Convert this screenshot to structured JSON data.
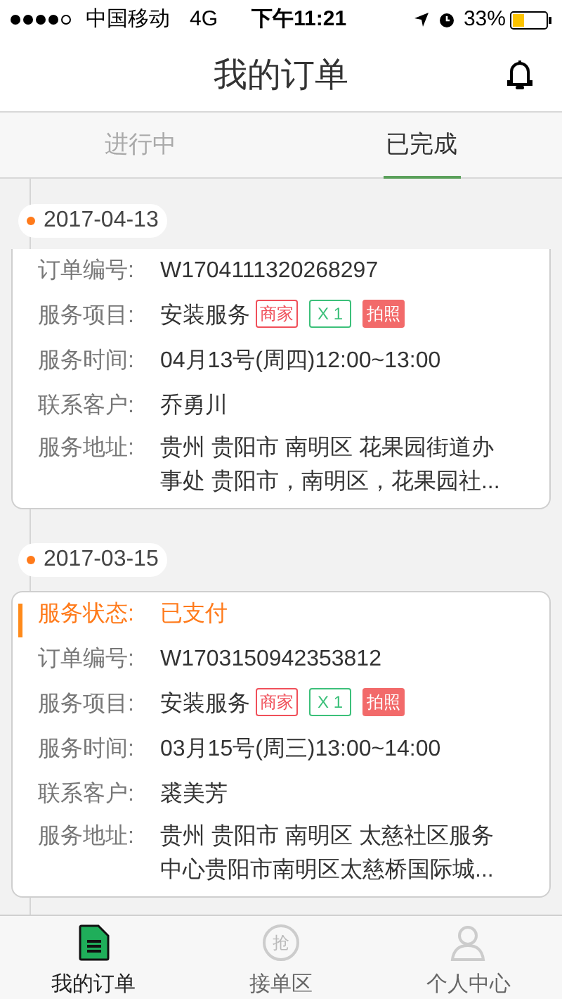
{
  "status_bar": {
    "carrier": "中国移动",
    "network": "4G",
    "time": "下午11:21",
    "battery": "33%"
  },
  "header": {
    "title": "我的订单"
  },
  "tabs": [
    {
      "label": "进行中",
      "selected": false
    },
    {
      "label": "已完成",
      "selected": true
    }
  ],
  "orders": [
    {
      "date": "2017-04-13",
      "top_cut": true,
      "fields": [
        {
          "label": "订单编号:",
          "value": "W1704111320268297"
        },
        {
          "kind": "tags",
          "label": "服务项目:",
          "value": "安装服务",
          "tags": [
            {
              "text": "商家",
              "kind": "outline",
              "color": "#f0505a"
            },
            {
              "text": "X 1",
              "kind": "outline",
              "color": "#3cc07a"
            },
            {
              "text": "拍照",
              "kind": "filled",
              "color": "#f26a6a"
            }
          ]
        },
        {
          "label": "服务时间:",
          "value": "04月13号(周四)12:00~13:00"
        },
        {
          "label": "联系客户:",
          "value": "乔勇川"
        },
        {
          "kind": "address",
          "label": "服务地址:",
          "value": "贵州 贵阳市 南明区 花果园街道办事处 贵阳市，南明区，花果园社..."
        }
      ]
    },
    {
      "date": "2017-03-15",
      "top_cut": false,
      "fields": [
        {
          "kind": "status",
          "label": "服务状态:",
          "value": "已支付"
        },
        {
          "label": "订单编号:",
          "value": "W1703150942353812"
        },
        {
          "kind": "tags",
          "label": "服务项目:",
          "value": "安装服务",
          "tags": [
            {
              "text": "商家",
              "kind": "outline",
              "color": "#f0505a"
            },
            {
              "text": "X 1",
              "kind": "outline",
              "color": "#3cc07a"
            },
            {
              "text": "拍照",
              "kind": "filled",
              "color": "#f26a6a"
            }
          ]
        },
        {
          "label": "服务时间:",
          "value": "03月15号(周三)13:00~14:00"
        },
        {
          "label": "联系客户:",
          "value": "裘美芳"
        },
        {
          "kind": "address",
          "label": "服务地址:",
          "value": "贵州 贵阳市 南明区  太慈社区服务中心贵阳市南明区太慈桥国际城..."
        }
      ]
    }
  ],
  "bottom_nav": [
    {
      "kind": "document",
      "label": "我的订单",
      "selected": true
    },
    {
      "kind": "grab",
      "label": "接单区",
      "glyph": "抢",
      "selected": false
    },
    {
      "kind": "person",
      "label": "个人中心",
      "selected": false
    }
  ]
}
